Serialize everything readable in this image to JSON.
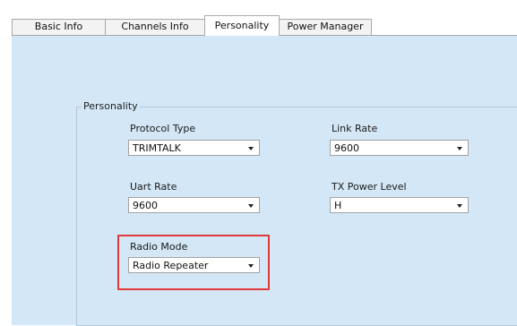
{
  "tabs": [
    {
      "label": "Basic Info",
      "active": false
    },
    {
      "label": "Channels Info",
      "active": false
    },
    {
      "label": "Personality",
      "active": true
    },
    {
      "label": "Power Manager",
      "active": false
    }
  ],
  "group": {
    "legend": "Personality"
  },
  "fields": {
    "protocol_type": {
      "label": "Protocol Type",
      "value": "TRIMTALK"
    },
    "link_rate": {
      "label": "Link Rate",
      "value": "9600"
    },
    "uart_rate": {
      "label": "Uart Rate",
      "value": "9600"
    },
    "tx_power_level": {
      "label": "TX Power Level",
      "value": "H"
    },
    "radio_mode": {
      "label": "Radio Mode",
      "value": "Radio Repeater"
    }
  },
  "colors": {
    "panel_bg": "#d3e7f6",
    "highlight_border": "#e23a3a"
  },
  "icons": {
    "dropdown": "chevron-down-icon"
  }
}
